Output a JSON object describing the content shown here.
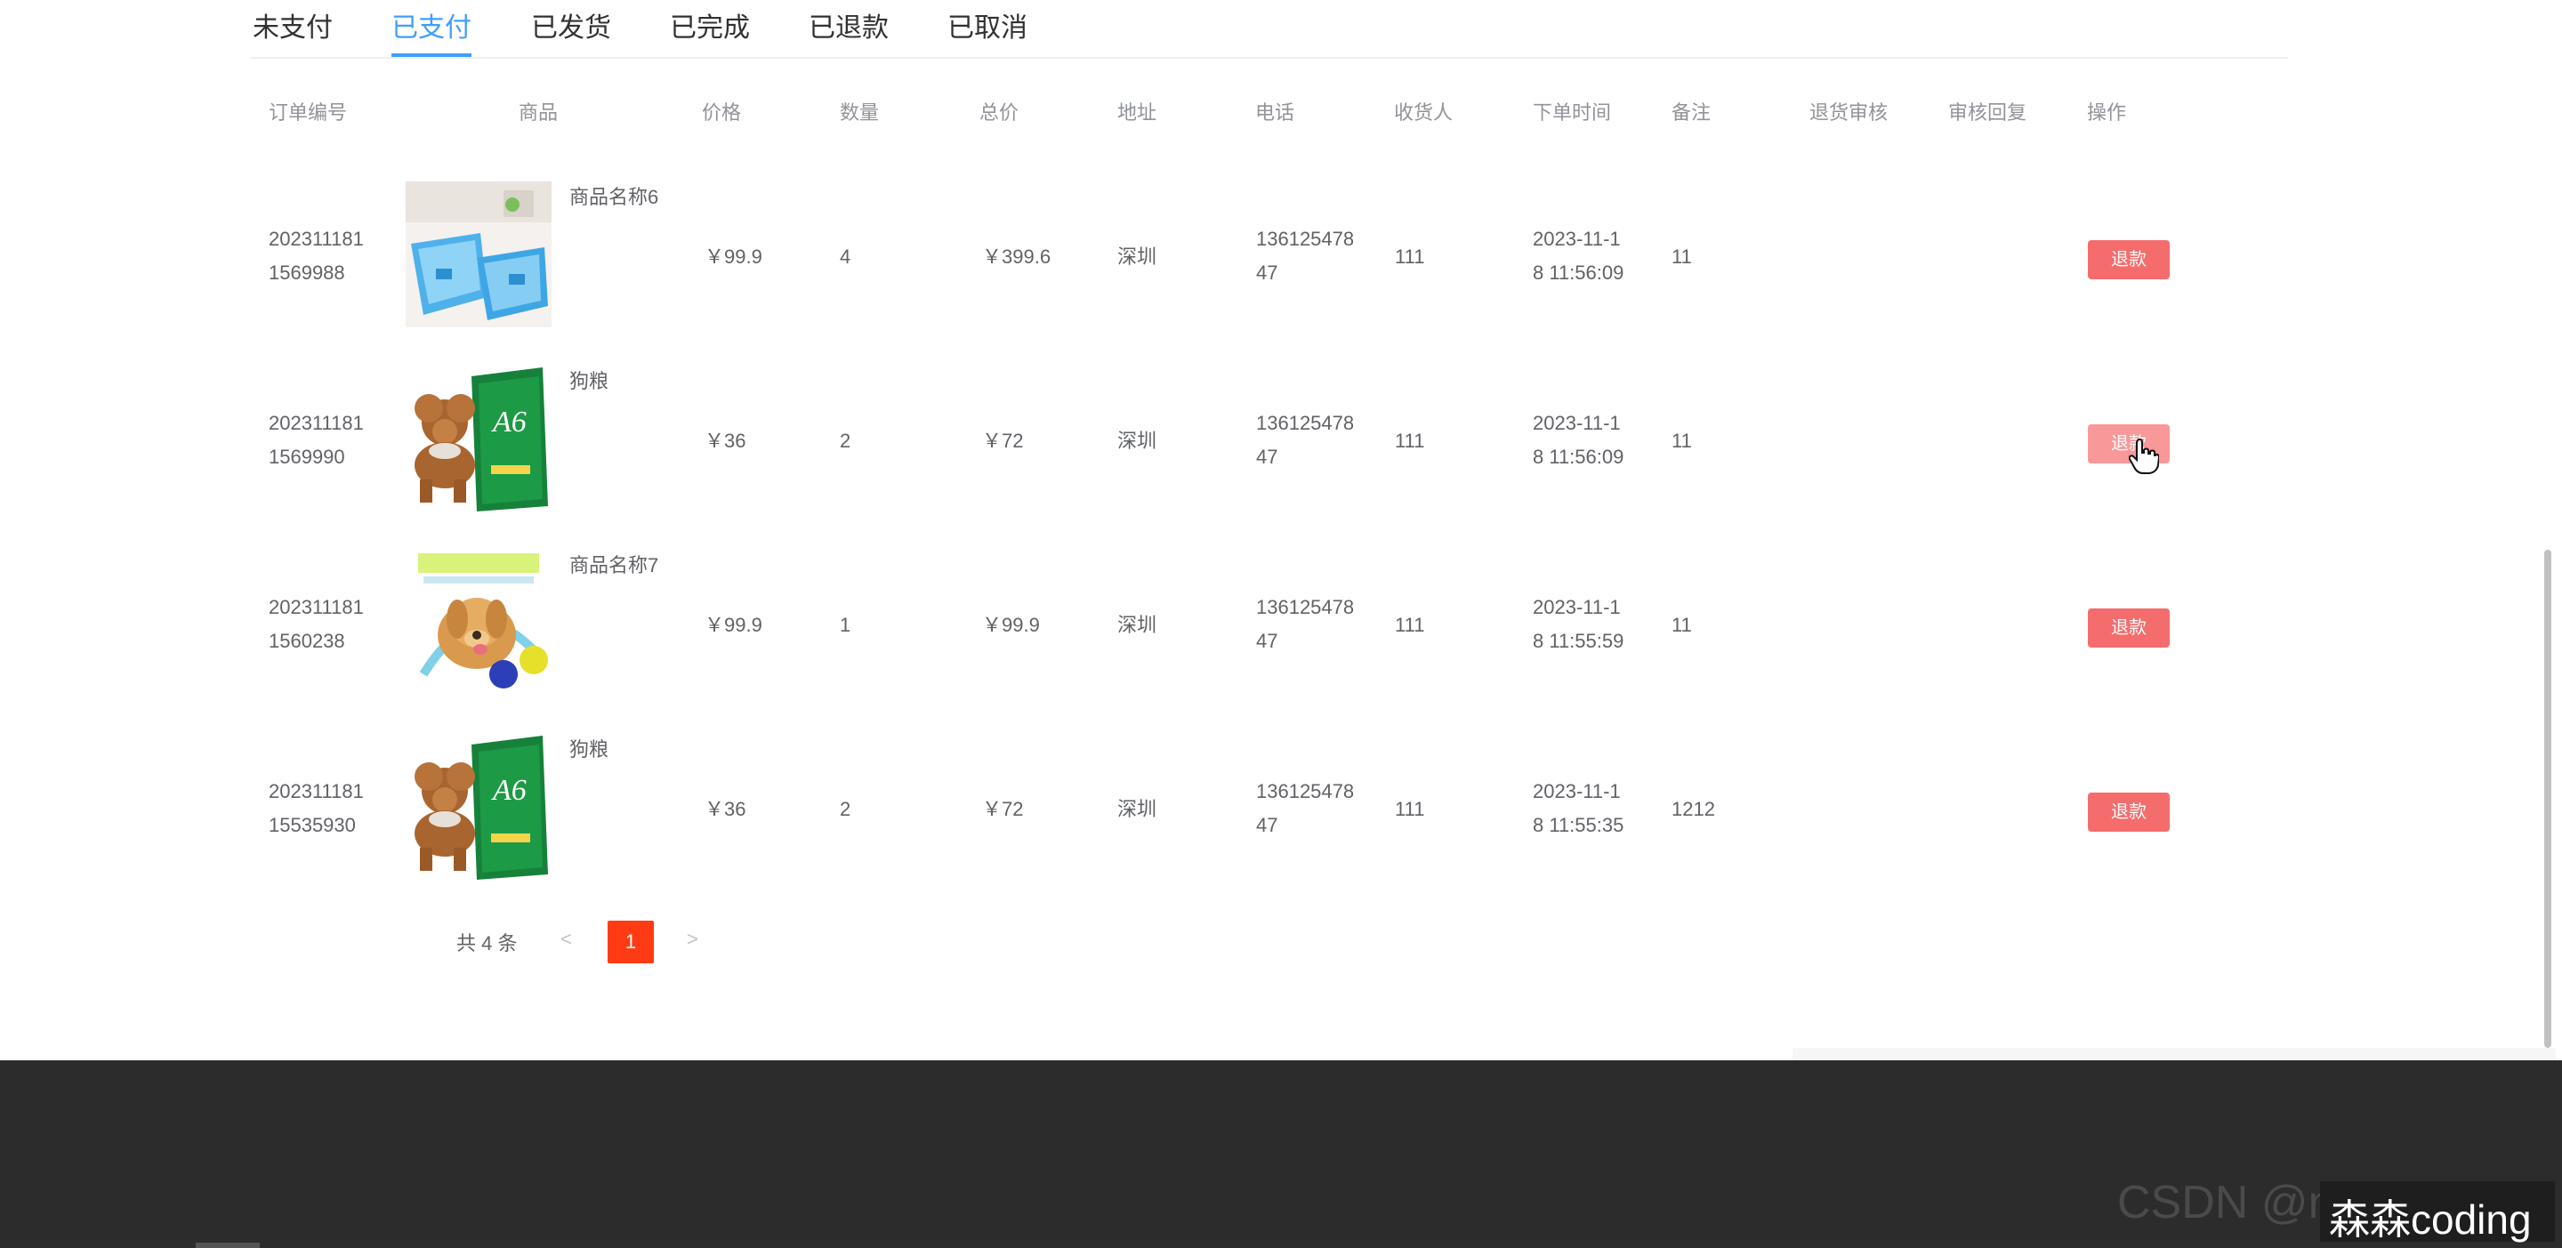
{
  "tabs": [
    "未支付",
    "已支付",
    "已发货",
    "已完成",
    "已退款",
    "已取消"
  ],
  "active_tab": "已支付",
  "columns": {
    "order_no": "订单编号",
    "product": "商品",
    "price": "价格",
    "qty": "数量",
    "total": "总价",
    "address": "地址",
    "phone": "电话",
    "receiver": "收货人",
    "order_time": "下单时间",
    "remark": "备注",
    "return_review": "退货审核",
    "review_reply": "审核回复",
    "action": "操作"
  },
  "orders": [
    {
      "order_no": "202311181\n1569988",
      "product_name": "商品名称6",
      "image": "pet-tray-image",
      "price": "￥99.9",
      "qty": "4",
      "total": "￥399.6",
      "address": "深圳",
      "phone": "136125478\n47",
      "receiver": "111",
      "order_time": "2023-11-1\n8 11:56:09",
      "remark": "11",
      "return_review": "",
      "review_reply": "",
      "action_label": "退款"
    },
    {
      "order_no": "202311181\n1569990",
      "product_name": "狗粮",
      "image": "dog-food-image",
      "price": "￥36",
      "qty": "2",
      "total": "￥72",
      "address": "深圳",
      "phone": "136125478\n47",
      "receiver": "111",
      "order_time": "2023-11-1\n8 11:56:09",
      "remark": "11",
      "return_review": "",
      "review_reply": "",
      "action_label": "退款"
    },
    {
      "order_no": "202311181\n1560238",
      "product_name": "商品名称7",
      "image": "dog-ball-image",
      "price": "￥99.9",
      "qty": "1",
      "total": "￥99.9",
      "address": "深圳",
      "phone": "136125478\n47",
      "receiver": "111",
      "order_time": "2023-11-1\n8 11:55:59",
      "remark": "11",
      "return_review": "",
      "review_reply": "",
      "action_label": "退款"
    },
    {
      "order_no": "202311181\n15535930",
      "product_name": "狗粮",
      "image": "dog-food-image",
      "price": "￥36",
      "qty": "2",
      "total": "￥72",
      "address": "深圳",
      "phone": "136125478\n47",
      "receiver": "111",
      "order_time": "2023-11-1\n8 11:55:35",
      "remark": "1212",
      "return_review": "",
      "review_reply": "",
      "action_label": "退款"
    }
  ],
  "pagination": {
    "total_text": "共 4 条",
    "prev": "<",
    "current": "1",
    "next": ">"
  },
  "footer": {
    "watermark": "森森coding",
    "blurred_text": "CSDN @ne"
  },
  "colors": {
    "accent": "#409eff",
    "danger": "#f56c6c",
    "page_active": "#ff3b14",
    "footer_bg": "#2c2c2c"
  }
}
